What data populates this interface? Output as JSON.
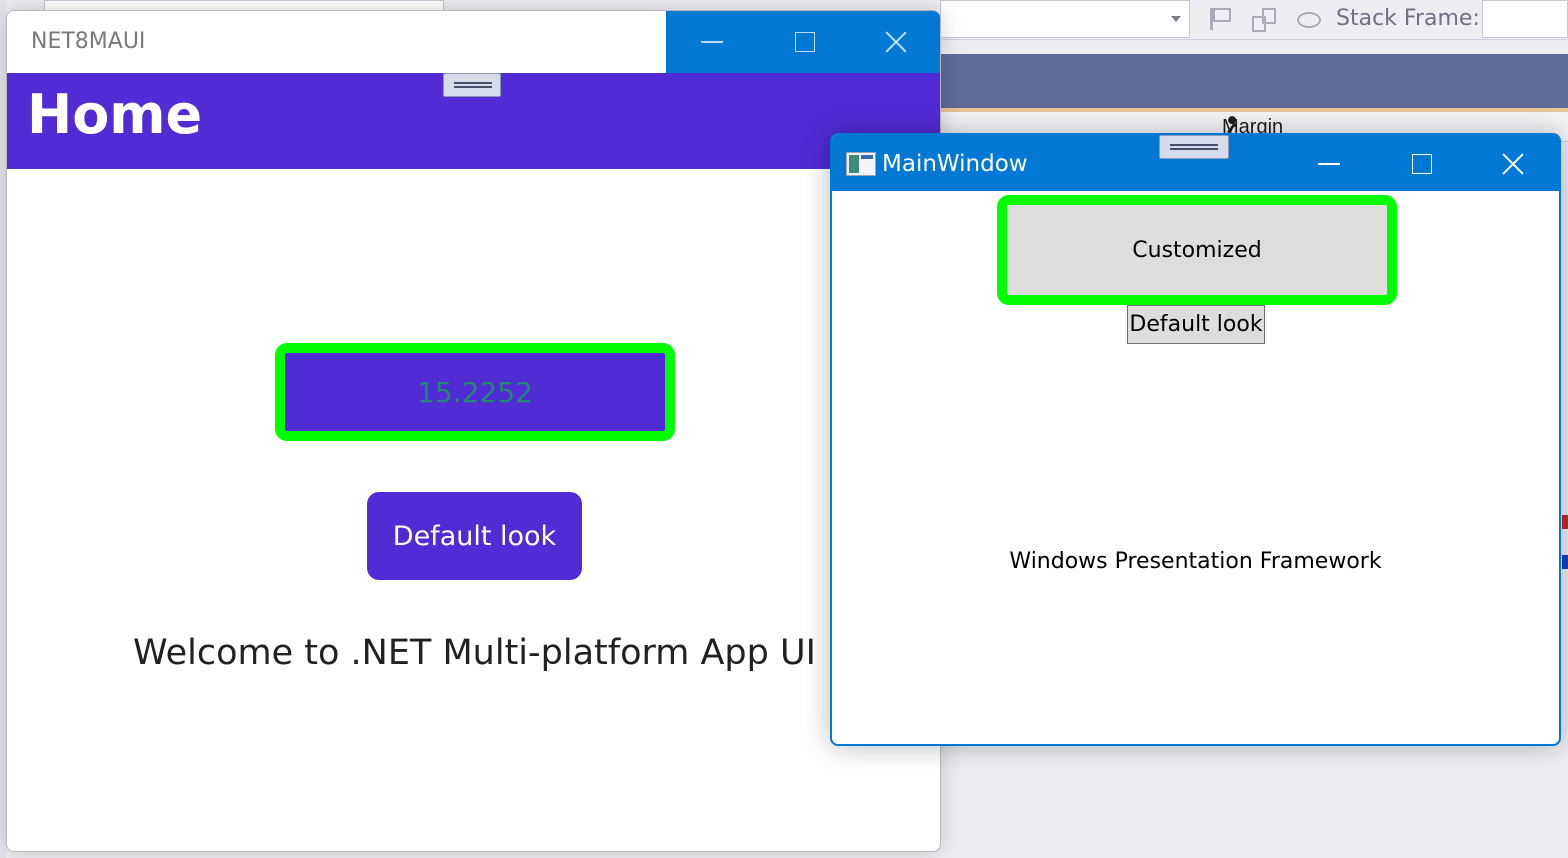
{
  "ide": {
    "stack_frame_label": "Stack Frame:",
    "margin_label": "Margin",
    "icons": [
      "flag-icon",
      "threads-icon",
      "fish-icon",
      "wrench-icon"
    ]
  },
  "maui": {
    "window_title": "NET8MAUI",
    "page_title": "Home",
    "custom_button_label": "15.2252",
    "default_button_label": "Default look",
    "welcome_text": "Welcome to .NET Multi-platform App UI",
    "colors": {
      "primary": "#512bd4",
      "caption": "#0078d4",
      "highlight_border": "#00ff00"
    }
  },
  "wpf": {
    "window_title": "MainWindow",
    "custom_button_label": "Customized",
    "default_button_label": "Default look",
    "label_text": "Windows Presentation Framework",
    "colors": {
      "caption": "#0078d4",
      "button_bg": "#dddddd",
      "highlight_border": "#00ff00"
    }
  }
}
